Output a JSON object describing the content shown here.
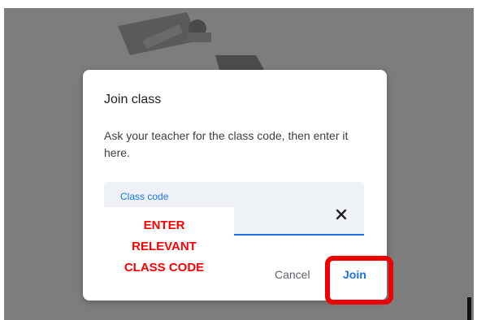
{
  "dialog": {
    "title": "Join class",
    "description": "Ask your teacher for the class code, then enter it here.",
    "code_field": {
      "label": "Class code",
      "value": "",
      "clear_icon": "close-icon"
    },
    "cancel_label": "Cancel",
    "join_label": "Join"
  },
  "annotation": {
    "lines": [
      "ENTER",
      "RELEVANT",
      "CLASS CODE"
    ],
    "color": "#ff0000"
  },
  "colors": {
    "accent": "#1a73e8",
    "highlight": "#ee0000",
    "overlay": "#7d7d7d"
  }
}
